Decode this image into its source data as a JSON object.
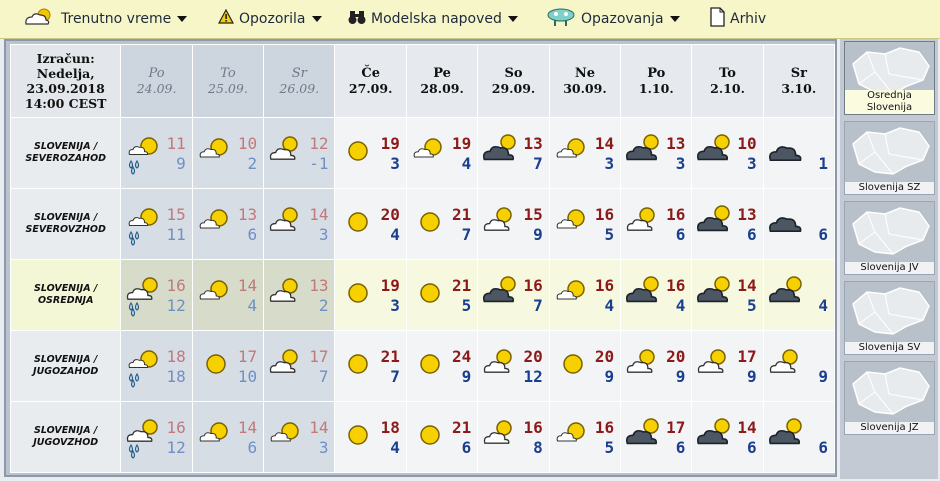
{
  "menu": [
    {
      "id": "trenutno",
      "label": "Trenutno vreme",
      "icon": "cloud-sun-icon",
      "has_caret": true
    },
    {
      "id": "opozorila",
      "label": "Opozorila",
      "icon": "warning-icon",
      "has_caret": true
    },
    {
      "id": "modelska",
      "label": "Modelska napoved",
      "icon": "binoculars-icon",
      "has_caret": true
    },
    {
      "id": "opazovanja",
      "label": "Opazovanja",
      "icon": "observer-icon",
      "has_caret": true
    },
    {
      "id": "arhiv",
      "label": "Arhiv",
      "icon": "document-icon",
      "has_caret": false
    }
  ],
  "calc": {
    "l1": "Izračun:",
    "l2": "Nedelja,",
    "l3": "23.09.2018",
    "l4": "14:00 CEST"
  },
  "days": [
    {
      "name": "Po",
      "date": "24.09.",
      "past": true
    },
    {
      "name": "To",
      "date": "25.09.",
      "past": true
    },
    {
      "name": "Sr",
      "date": "26.09.",
      "past": true
    },
    {
      "name": "Če",
      "date": "27.09.",
      "past": false
    },
    {
      "name": "Pe",
      "date": "28.09.",
      "past": false
    },
    {
      "name": "So",
      "date": "29.09.",
      "past": false
    },
    {
      "name": "Ne",
      "date": "30.09.",
      "past": false
    },
    {
      "name": "Po",
      "date": "1.10.",
      "past": false
    },
    {
      "name": "To",
      "date": "2.10.",
      "past": false
    },
    {
      "name": "Sr",
      "date": "3.10.",
      "past": false
    }
  ],
  "regions": [
    {
      "l1": "SLOVENIJA /",
      "l2": "SEVEROZAHOD",
      "highlight": false,
      "cells": [
        {
          "icon": "sun-cloud-rain",
          "max": "11",
          "min": "9"
        },
        {
          "icon": "sun-cloud",
          "max": "10",
          "min": "2"
        },
        {
          "icon": "cloud-sun",
          "max": "12",
          "min": "-1"
        },
        {
          "icon": "sun",
          "max": "19",
          "min": "3"
        },
        {
          "icon": "sun-cloud",
          "max": "19",
          "min": "4"
        },
        {
          "icon": "dark-cloud-sun",
          "max": "13",
          "min": "7"
        },
        {
          "icon": "sun-cloud",
          "max": "14",
          "min": "3"
        },
        {
          "icon": "dark-cloud-sun",
          "max": "13",
          "min": "3"
        },
        {
          "icon": "dark-cloud-sun",
          "max": "10",
          "min": "3"
        },
        {
          "icon": "dark-cloud",
          "max": "",
          "min": "1"
        }
      ]
    },
    {
      "l1": "SLOVENIJA /",
      "l2": "SEVEROVZHOD",
      "highlight": false,
      "cells": [
        {
          "icon": "sun-cloud-rain",
          "max": "15",
          "min": "11"
        },
        {
          "icon": "sun-cloud",
          "max": "13",
          "min": "6"
        },
        {
          "icon": "cloud-sun",
          "max": "14",
          "min": "3"
        },
        {
          "icon": "sun",
          "max": "20",
          "min": "4"
        },
        {
          "icon": "sun",
          "max": "21",
          "min": "7"
        },
        {
          "icon": "cloud-sun",
          "max": "15",
          "min": "9"
        },
        {
          "icon": "sun-cloud",
          "max": "16",
          "min": "5"
        },
        {
          "icon": "cloud-sun",
          "max": "16",
          "min": "6"
        },
        {
          "icon": "dark-cloud-sun",
          "max": "13",
          "min": "6"
        },
        {
          "icon": "dark-cloud",
          "max": "",
          "min": "6"
        }
      ]
    },
    {
      "l1": "SLOVENIJA /",
      "l2": "OSREDNJA",
      "highlight": true,
      "cells": [
        {
          "icon": "cloud-sun-rain",
          "max": "16",
          "min": "12"
        },
        {
          "icon": "sun-cloud",
          "max": "14",
          "min": "4"
        },
        {
          "icon": "cloud-sun",
          "max": "13",
          "min": "2"
        },
        {
          "icon": "sun",
          "max": "19",
          "min": "3"
        },
        {
          "icon": "sun",
          "max": "21",
          "min": "5"
        },
        {
          "icon": "dark-cloud-sun",
          "max": "16",
          "min": "7"
        },
        {
          "icon": "sun-cloud",
          "max": "16",
          "min": "4"
        },
        {
          "icon": "dark-cloud-sun",
          "max": "16",
          "min": "4"
        },
        {
          "icon": "dark-cloud-sun",
          "max": "14",
          "min": "5"
        },
        {
          "icon": "dark-cloud-sun",
          "max": "",
          "min": "4"
        }
      ]
    },
    {
      "l1": "SLOVENIJA /",
      "l2": "JUGOZAHOD",
      "highlight": false,
      "cells": [
        {
          "icon": "sun-cloud-rain",
          "max": "18",
          "min": "18"
        },
        {
          "icon": "sun",
          "max": "17",
          "min": "10"
        },
        {
          "icon": "cloud-sun",
          "max": "17",
          "min": "7"
        },
        {
          "icon": "sun",
          "max": "21",
          "min": "7"
        },
        {
          "icon": "sun",
          "max": "24",
          "min": "9"
        },
        {
          "icon": "cloud-sun",
          "max": "20",
          "min": "12"
        },
        {
          "icon": "sun",
          "max": "20",
          "min": "9"
        },
        {
          "icon": "cloud-sun",
          "max": "20",
          "min": "9"
        },
        {
          "icon": "cloud-sun",
          "max": "17",
          "min": "9"
        },
        {
          "icon": "cloud-sun",
          "max": "",
          "min": "9"
        }
      ]
    },
    {
      "l1": "SLOVENIJA /",
      "l2": "JUGOVZHOD",
      "highlight": false,
      "cells": [
        {
          "icon": "cloud-sun-rain",
          "max": "16",
          "min": "12"
        },
        {
          "icon": "sun-cloud",
          "max": "14",
          "min": "6"
        },
        {
          "icon": "sun-cloud",
          "max": "14",
          "min": "3"
        },
        {
          "icon": "sun",
          "max": "18",
          "min": "4"
        },
        {
          "icon": "sun",
          "max": "21",
          "min": "6"
        },
        {
          "icon": "cloud-sun",
          "max": "16",
          "min": "8"
        },
        {
          "icon": "sun-cloud",
          "max": "16",
          "min": "5"
        },
        {
          "icon": "dark-cloud-sun",
          "max": "17",
          "min": "6"
        },
        {
          "icon": "dark-cloud-sun",
          "max": "14",
          "min": "6"
        },
        {
          "icon": "dark-cloud-sun",
          "max": "",
          "min": "6"
        }
      ]
    }
  ],
  "maps": [
    {
      "label_l1": "Osrednja",
      "label_l2": "Slovenija",
      "selected": true
    },
    {
      "label_l1": "Slovenija SZ",
      "label_l2": "",
      "selected": false
    },
    {
      "label_l1": "Slovenija JV",
      "label_l2": "",
      "selected": false
    },
    {
      "label_l1": "Slovenija SV",
      "label_l2": "",
      "selected": false
    },
    {
      "label_l1": "Slovenija JZ",
      "label_l2": "",
      "selected": false
    }
  ]
}
